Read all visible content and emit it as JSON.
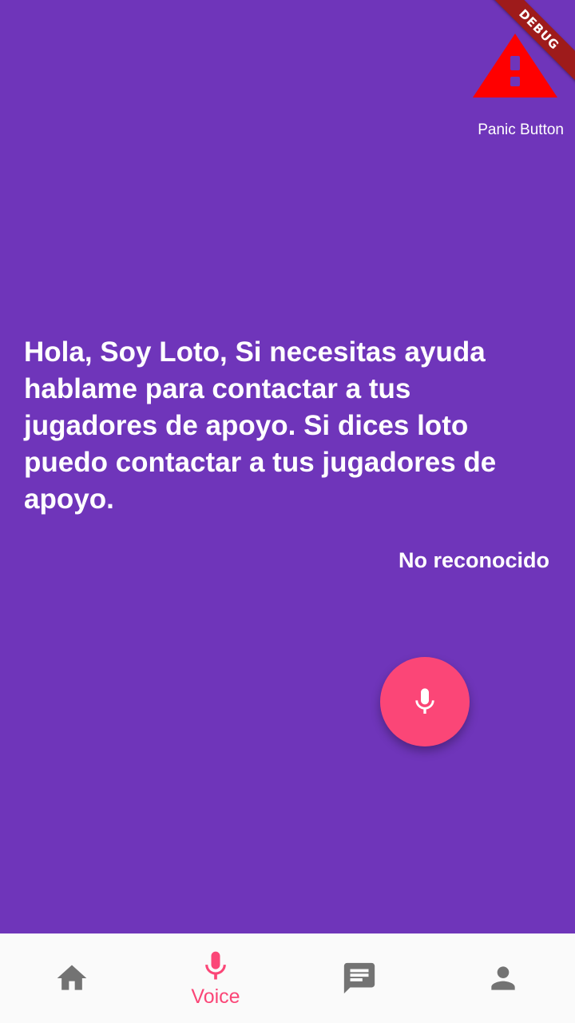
{
  "debug_banner": {
    "label": "DEBUG"
  },
  "panic": {
    "label": "Panic Button",
    "icon": "warning-icon",
    "color": "#ff0000"
  },
  "main": {
    "message": "Hola, Soy Loto, Si necesitas ayuda hablame para contactar a tus jugadores de apoyo. Si dices loto puedo contactar a tus jugadores de apoyo.",
    "status": "No reconocido"
  },
  "fab": {
    "icon": "mic-icon",
    "color": "#fb4677"
  },
  "bottom_nav": {
    "items": [
      {
        "icon": "home-icon",
        "label": ""
      },
      {
        "icon": "mic-icon",
        "label": "Voice",
        "active": true
      },
      {
        "icon": "chat-icon",
        "label": ""
      },
      {
        "icon": "person-icon",
        "label": ""
      }
    ],
    "active_color": "#fb4677",
    "inactive_color": "#737373"
  },
  "colors": {
    "background": "#6f35ba",
    "nav_background": "#fafafa"
  }
}
